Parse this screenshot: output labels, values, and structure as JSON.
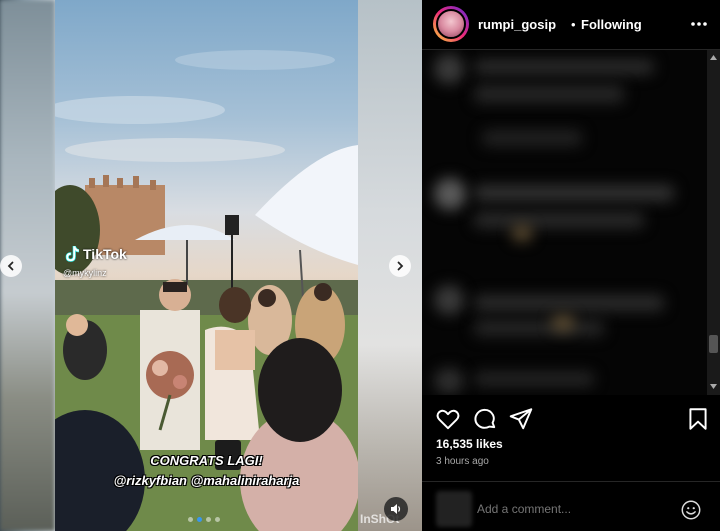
{
  "post": {
    "username": "rumpi_gosip",
    "separator": "•",
    "follow_status": "Following",
    "likes": "16,535 likes",
    "time_ago": "3 hours ago",
    "comment_placeholder": "Add a comment..."
  },
  "media": {
    "watermark_brand": "TikTok",
    "watermark_handle": "@mykylinz",
    "caption_line1": "CONGRATS LAGI!",
    "caption_line2": "@rizkyfbian @mahaliniraharja",
    "editor_watermark": "InShOt",
    "carousel_total": 4,
    "carousel_active": 1
  },
  "icons": {
    "prev": "chevron-left-icon",
    "next": "chevron-right-icon",
    "more": "more-horizontal-icon",
    "like": "heart-icon",
    "comment": "comment-icon",
    "share": "share-icon",
    "save": "bookmark-icon",
    "emoji": "emoji-icon",
    "audio": "speaker-icon"
  },
  "colors": {
    "panel_bg": "#000000",
    "text_primary": "#f5f5f5",
    "text_secondary": "#a8a8a8",
    "active_dot": "#3897f0"
  }
}
